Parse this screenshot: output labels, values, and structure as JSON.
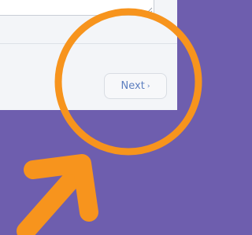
{
  "form": {
    "next_label": "Next",
    "next_icon": "chevron-right-icon",
    "next_glyph": "›"
  },
  "annotation": {
    "color": "#f7941d",
    "shapes": [
      "circle-highlight",
      "arrow-pointer"
    ]
  },
  "colors": {
    "background": "#6e5eae",
    "card": "#f3f5f8",
    "button_text": "#5d7fc0"
  }
}
